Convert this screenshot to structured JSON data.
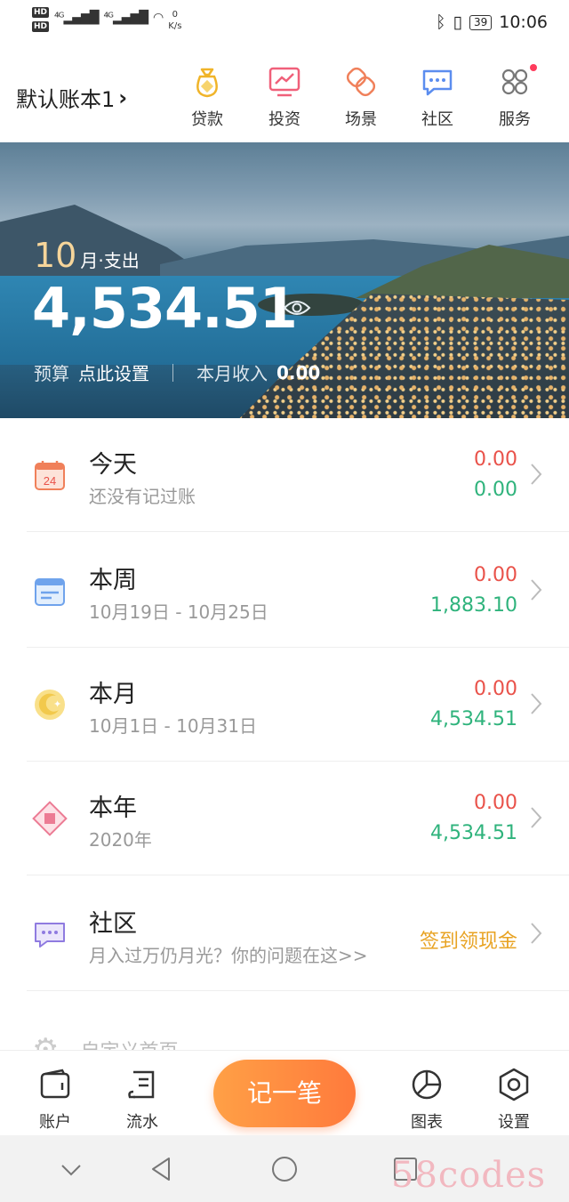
{
  "status_bar": {
    "network_speed_value": "0",
    "network_speed_unit": "K/s",
    "battery": "39",
    "time": "10:06"
  },
  "header": {
    "book_name": "默认账本1",
    "nav": [
      {
        "label": "贷款",
        "icon": "money-bag-icon"
      },
      {
        "label": "投资",
        "icon": "chart-trend-icon"
      },
      {
        "label": "场景",
        "icon": "link-rings-icon"
      },
      {
        "label": "社区",
        "icon": "chat-bubble-icon"
      },
      {
        "label": "服务",
        "icon": "grid-services-icon"
      }
    ]
  },
  "banner": {
    "month_number": "10",
    "month_suffix": "月·支出",
    "expense_amount": "4,534.51",
    "budget_label": "预算",
    "budget_action": "点此设置",
    "income_label": "本月收入",
    "income_value": "0.00"
  },
  "rows": [
    {
      "title": "今天",
      "subtitle": "还没有记过账",
      "value_expense": "0.00",
      "value_income": "0.00",
      "icon": "calendar-24-icon"
    },
    {
      "title": "本周",
      "subtitle": "10月19日 - 10月25日",
      "value_expense": "0.00",
      "value_income": "1,883.10",
      "icon": "week-calendar-icon"
    },
    {
      "title": "本月",
      "subtitle": "10月1日 - 10月31日",
      "value_expense": "0.00",
      "value_income": "4,534.51",
      "icon": "moon-star-icon"
    },
    {
      "title": "本年",
      "subtitle": "2020年",
      "value_expense": "0.00",
      "value_income": "4,534.51",
      "icon": "diamond-year-icon"
    }
  ],
  "community": {
    "title": "社区",
    "subtitle": "月入过万仍月光？你的问题在这>>",
    "promo": "签到领现金"
  },
  "customize": {
    "label": "自定义首页"
  },
  "tabbar": {
    "account": "账户",
    "flow": "流水",
    "record": "记一笔",
    "chart": "图表",
    "settings": "设置"
  },
  "watermark": "58codes",
  "colors": {
    "expense": "#e9524a",
    "income": "#2fb37c",
    "promo": "#e8a323",
    "record_button": "#ff8a3d"
  }
}
